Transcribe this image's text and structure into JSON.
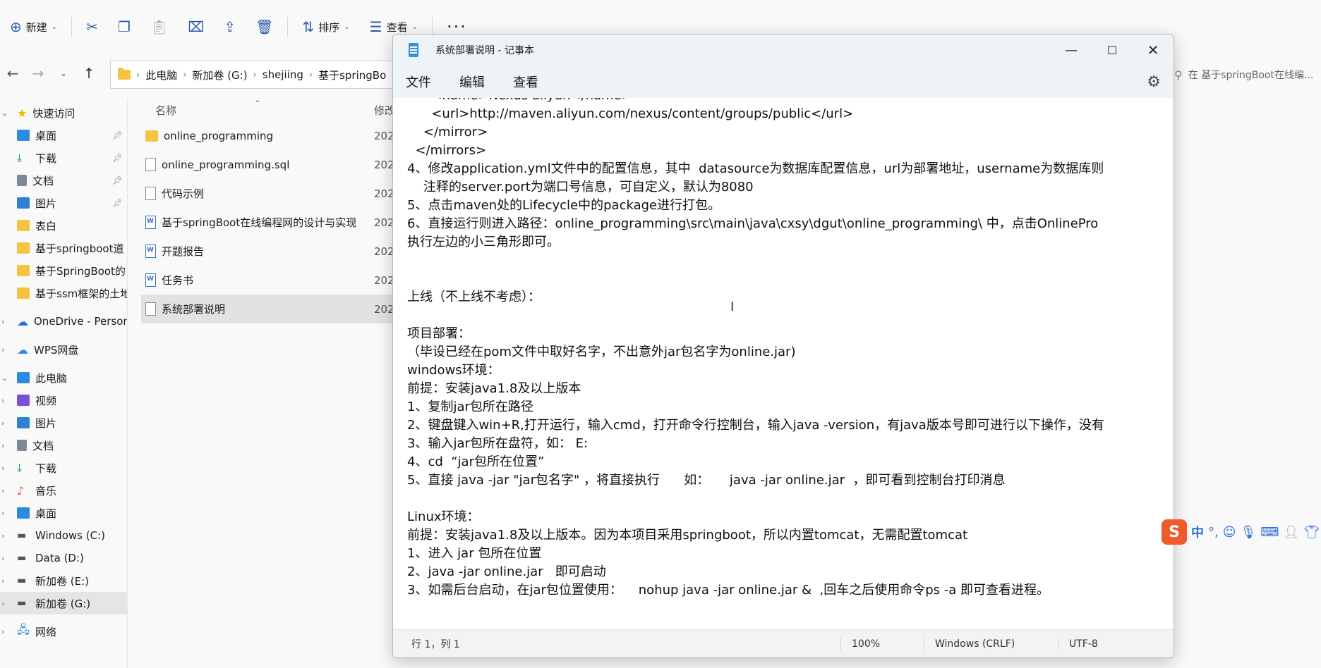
{
  "explorer": {
    "toolbar": {
      "new_label": "新建",
      "sort_label": "排序",
      "view_label": "查看"
    },
    "breadcrumbs": [
      "此电脑",
      "新加卷 (G:)",
      "shejiing",
      "基于springBo"
    ],
    "search_placeholder": "在 基于springBoot在线编...",
    "sidebar": {
      "quick_access": "快速访问",
      "quick_items": [
        "桌面",
        "下载",
        "文档",
        "图片",
        "表白",
        "基于springboot道",
        "基于SpringBoot的",
        "基于ssm框架的土地"
      ],
      "onedrive": "OneDrive - Persona",
      "wps": "WPS网盘",
      "this_pc": "此电脑",
      "pc_items": [
        "视频",
        "图片",
        "文档",
        "下载",
        "音乐",
        "桌面",
        "Windows (C:)",
        "Data (D:)",
        "新加卷 (E:)",
        "新加卷 (G:)"
      ],
      "network": "网络"
    },
    "filelist": {
      "col_name": "名称",
      "col_modified": "修改",
      "rows": [
        {
          "name": "online_programming",
          "date": "202"
        },
        {
          "name": "online_programming.sql",
          "date": "202"
        },
        {
          "name": "代码示例",
          "date": "202"
        },
        {
          "name": "基于springBoot在线编程网的设计与实现",
          "date": "202"
        },
        {
          "name": "开题报告",
          "date": "202"
        },
        {
          "name": "任务书",
          "date": "202"
        },
        {
          "name": "系统部署说明",
          "date": "202"
        }
      ]
    }
  },
  "notepad": {
    "title": "系统部署说明 - 记事本",
    "menu": [
      "文件",
      "编辑",
      "查看"
    ],
    "content": "      <name>Nexus aliyun</name>\n      <url>http://maven.aliyun.com/nexus/content/groups/public</url>\n    </mirror>\n  </mirrors>\n4、修改application.yml文件中的配置信息，其中  datasource为数据库配置信息，url为部署地址，username为数据库则\n    注释的server.port为端口号信息，可自定义，默认为8080\n5、点击maven处的Lifecycle中的package进行打包。\n6、直接运行则进入路径：online_programming\\src\\main\\java\\cxsy\\dgut\\online_programming\\ 中，点击OnlinePro\n执行左边的小三角形即可。\n\n\n上线（不上线不考虑）：\n\n项目部署：\n（毕设已经在pom文件中取好名字，不出意外jar包名字为online.jar)\nwindows环境：\n前提：安装java1.8及以上版本\n1、复制jar包所在路径\n2、键盘键入win+R,打开运行，输入cmd，打开命令行控制台，输入java -version，有java版本号即可进行以下操作，没有\n3、输入jar包所在盘符，如： E:\n4、cd  “jar包所在位置”\n5、直接 java -jar \"jar包名字\" ，将直接执行      如：     java -jar online.jar  ，即可看到控制台打印消息\n\nLinux环境：\n前提：安装java1.8及以上版本。因为本项目采用springboot，所以内置tomcat，无需配置tomcat\n1、进入 jar 包所在位置\n2、java -jar online.jar   即可启动\n3、如需后台启动，在jar包位置使用：    nohup java -jar online.jar &  ,回车之后使用命令ps -a 即可查看进程。",
    "status": {
      "position": "行 1，列 1",
      "zoom": "100%",
      "eol": "Windows (CRLF)",
      "encoding": "UTF-8"
    }
  },
  "ime": {
    "mode": "中",
    "punct": "°,"
  }
}
